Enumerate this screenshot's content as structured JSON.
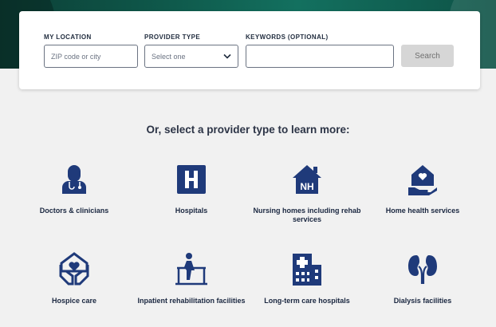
{
  "search": {
    "location_label": "MY LOCATION",
    "location_placeholder": "ZIP code or city",
    "provider_label": "PROVIDER TYPE",
    "provider_selected": "Select one",
    "keywords_label": "KEYWORDS (OPTIONAL)",
    "keywords_placeholder": "",
    "button_label": "Search"
  },
  "subtitle": "Or, select a provider type to learn more:",
  "providers": [
    {
      "label": "Doctors & clinicians",
      "icon": "doctor-icon"
    },
    {
      "label": "Hospitals",
      "icon": "hospital-h-icon"
    },
    {
      "label": "Nursing homes including rehab services",
      "icon": "nursing-home-icon"
    },
    {
      "label": "Home health services",
      "icon": "home-health-icon"
    },
    {
      "label": "Hospice care",
      "icon": "hospice-icon"
    },
    {
      "label": "Inpatient rehabilitation facilities",
      "icon": "rehab-icon"
    },
    {
      "label": "Long-term care hospitals",
      "icon": "long-term-care-icon"
    },
    {
      "label": "Dialysis facilities",
      "icon": "kidneys-icon"
    }
  ],
  "colors": {
    "icon": "#1f3a7a",
    "hero": "#0f5a4c",
    "background": "#f1f1f1"
  }
}
